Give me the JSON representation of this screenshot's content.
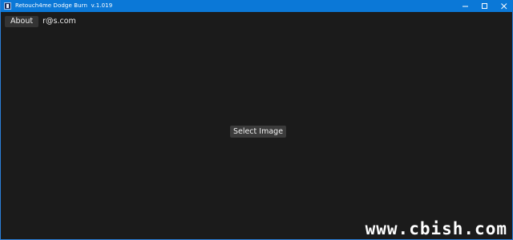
{
  "window": {
    "title": "Retouch4me Dodge Burn  v.1.019"
  },
  "toolbar": {
    "about_label": "About",
    "email": "r@s.com"
  },
  "main": {
    "select_image_label": "Select Image"
  },
  "watermark": "www.cbish.com",
  "colors": {
    "titlebar": "#0b78d7",
    "background": "#1b1b1b",
    "button": "#3b3b3b"
  }
}
